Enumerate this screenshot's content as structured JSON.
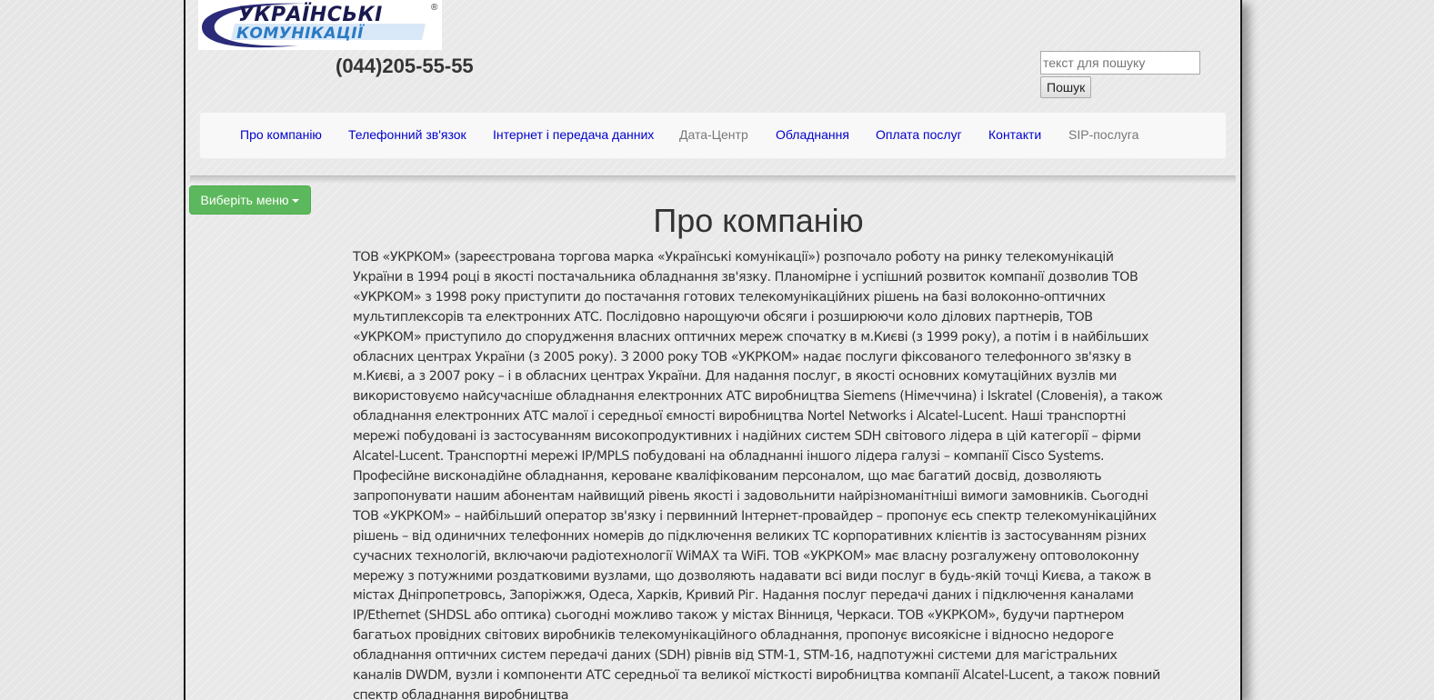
{
  "header": {
    "logo": {
      "line1": "УКРАЇНСЬКІ",
      "line2": "КОМУНІКАЦІЇ",
      "reg_mark": "®"
    },
    "phone": "(044)205-55-55",
    "search": {
      "placeholder": "текст для пошуку",
      "value": "",
      "button_label": "Пошук"
    }
  },
  "nav": {
    "items": [
      {
        "label": "Про компанію",
        "style": "link"
      },
      {
        "label": "Телефонний зв'язок",
        "style": "link"
      },
      {
        "label": "Інтернет і передача данних",
        "style": "link"
      },
      {
        "label": "Дата-Центр",
        "style": "muted"
      },
      {
        "label": "Обладнання",
        "style": "link"
      },
      {
        "label": "Оплата послуг",
        "style": "link"
      },
      {
        "label": "Контакти",
        "style": "link"
      },
      {
        "label": "SIP-послуга",
        "style": "muted"
      }
    ]
  },
  "sidebar": {
    "menu_button_label": "Виберіть меню"
  },
  "main": {
    "title": "Про компанію",
    "body": "ТОВ «УКРКОМ» (зареєстрована торгова марка «Українські комунікації») розпочало роботу на ринку телекомунікацій України в 1994 році в якості постачальника обладнання зв'язку. Планомірне і успішний розвиток компанії дозволив ТОВ «УКРКОМ» з 1998 року приступити до постачання готових телекомунікаційних рішень на базі волоконно-оптичних мультиплексорів та електронних АТС. Послідовно нарощуючи обсяги і розширюючи коло ділових партнерів, ТОВ «УКРКОМ» приступило до спорудження власних оптичних мереж спочатку в м.Києві (з 1999 року), а потім і в найбільших обласних центрах України (з 2005 року). З 2000 року ТОВ «УКРКОМ» надає послуги фіксованого телефонного зв'язку в м.Києві, а з 2007 року – і в обласних центрах України. Для надання послуг, в якості основних комутаційних вузлів ми використовуємо найсучасніше обладнання електронних АТС виробництва Siemens (Німеччина) і Iskratel (Словенія), а також обладнання електронних АТС малої і середньої ємності виробництва Nortel Networks і Alcatel-Lucent. Наші транспортні мережі побудовані із застосуванням високопродуктивних і надійних систем SDH світового лідера в цій категорії – фірми Alcatel-Lucent. Транспортні мережі IP/MPLS побудовані на обладнанні іншого лідера галузі – компанії Cisco Systems. Професійне висконадійне обладнання, кероване кваліфікованим персоналом, що має багатий досвід, дозволяють запропонувати нашим абонентам найвищий рівень якості і задовольнити найрізноманітніші вимоги замовників. Сьогодні ТОВ «УКРКОМ» – найбільший оператор зв'язку і первинний Інтернет-провайдер – пропонує есь спектр телекомунікаційних рішень – від одиничних телефонних номерів до підключення великих ТС корпоративних клієнтів із застосуванням різних сучасних технологій, включаючи радіотехнології WiMAX та WiFi. ТОВ «УКРКОМ» має власну розгалужену оптоволоконну мережу з потужними роздатковими вузлами, що дозволяють надавати всі види послуг в будь-якій точці Києва, а також в містах Дніпропетровсь, Запоріжжя, Одеса, Харків, Кривий Ріг. Надання послуг передачі даних і підключення каналами IP/Ethernet (SHDSL або оптика) сьогодні можливо також у містах Вінниця, Черкаси. ТОВ «УКРКОМ», будучи партнером багатьох провідних світових виробників телекомунікаційного обладнання, пропонує висоякісне і відносно недороге обладнання оптичних систем передачі даних (SDH) рівнів від STM-1, STM-16, надпотужні системи для магістральних каналів DWDM, вузли і компоненти АТС середньої та великої місткості виробництва компанії Alcatel-Lucent, а також повний спектр обладнання виробництва"
  },
  "colors": {
    "nav_link": "#0000cc",
    "nav_muted": "#777777",
    "menu_button": "#5cb85c",
    "text": "#333333"
  }
}
